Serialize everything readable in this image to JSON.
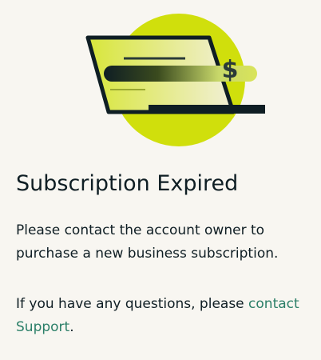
{
  "dialog": {
    "illustration_icon": "laptop-card-dollar-icon",
    "title": "Subscription Expired",
    "message": "Please contact the account owner to purchase a new business subscription.",
    "support_prefix": "If you have any questions, please ",
    "support_link_label": "contact Support",
    "support_suffix": "."
  },
  "colors": {
    "background": "#f8f6f1",
    "accent_lime": "#d0df0c",
    "text": "#0f1e24",
    "link": "#2b7f68"
  }
}
